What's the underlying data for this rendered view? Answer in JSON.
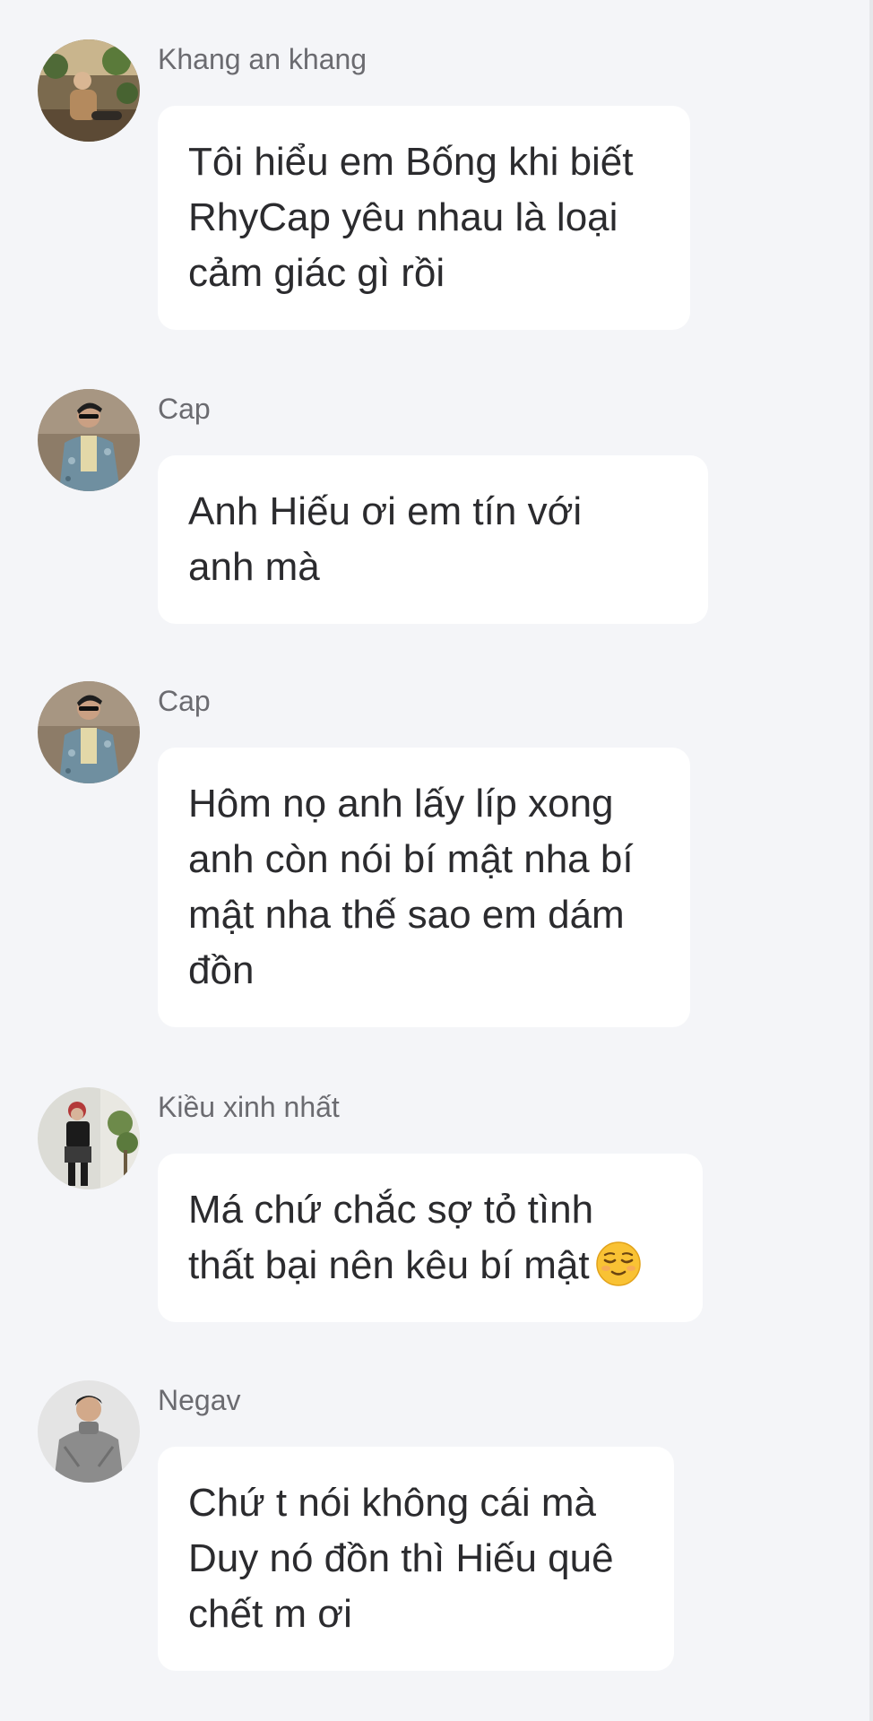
{
  "messages": [
    {
      "sender": "Khang an khang",
      "avatar_icon": "user-avatar-plants-photo",
      "lines": [
        "Tôi hiểu em Bống khi biết",
        "RhyCap yêu nhau là loại",
        "cảm giác gì rồi"
      ]
    },
    {
      "sender": "Cap",
      "avatar_icon": "user-avatar-denim-jacket-photo",
      "lines": [
        "Anh Hiếu ơi em tín với",
        "anh mà"
      ]
    },
    {
      "sender": "Cap",
      "avatar_icon": "user-avatar-denim-jacket-photo",
      "lines": [
        "Hôm nọ anh lấy líp xong",
        "anh còn nói bí mật nha bí",
        "mật nha thế sao em dám",
        "đồn"
      ]
    },
    {
      "sender": "Kiều xinh nhất",
      "avatar_icon": "user-avatar-black-outfit-photo",
      "lines": [
        "Má chứ chắc sợ tỏ tình",
        "thất bại nên kêu bí mật"
      ],
      "emoji": "relieved-face-emoji"
    },
    {
      "sender": "Negav",
      "avatar_icon": "user-avatar-grey-sweater-photo",
      "lines": [
        "Chứ t nói không cái mà",
        "Duy nó đồn thì Hiếu quê",
        "chết m ơi"
      ]
    }
  ],
  "colors": {
    "background": "#f4f5f8",
    "bubble": "#ffffff",
    "sender_text": "#6b6b70",
    "message_text": "#2b2b2e"
  }
}
